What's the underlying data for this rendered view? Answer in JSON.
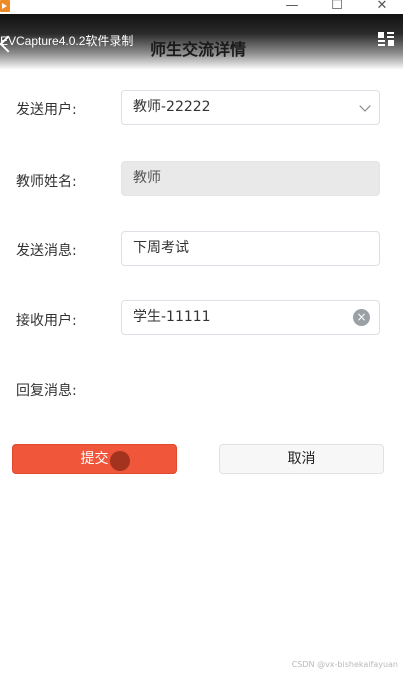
{
  "window": {
    "minimize_glyph": "—",
    "maximize_glyph": "☐",
    "close_glyph": "✕"
  },
  "header": {
    "capture_label": "EVCapture4.0.2软件录制",
    "title": "师生交流详情"
  },
  "form": {
    "send_user": {
      "label": "发送用户:",
      "value": "教师-22222"
    },
    "teacher_name": {
      "label": "教师姓名:",
      "value": "教师"
    },
    "send_message": {
      "label": "发送消息:",
      "value": "下周考试"
    },
    "receive_user": {
      "label": "接收用户:",
      "value": "学生-11111"
    },
    "reply_message": {
      "label": "回复消息:",
      "value": ""
    }
  },
  "actions": {
    "submit_label": "提交",
    "cancel_label": "取消"
  },
  "watermark": "CSDN @vx-bishekaifayuan",
  "colors": {
    "accent": "#f0563a",
    "header_dark": "#111111"
  },
  "icons": {
    "app": "app-logo-icon",
    "back": "back-arrow-icon",
    "menu": "grid-menu-icon",
    "dropdown": "chevron-down-icon",
    "clear": "clear-circle-icon"
  }
}
